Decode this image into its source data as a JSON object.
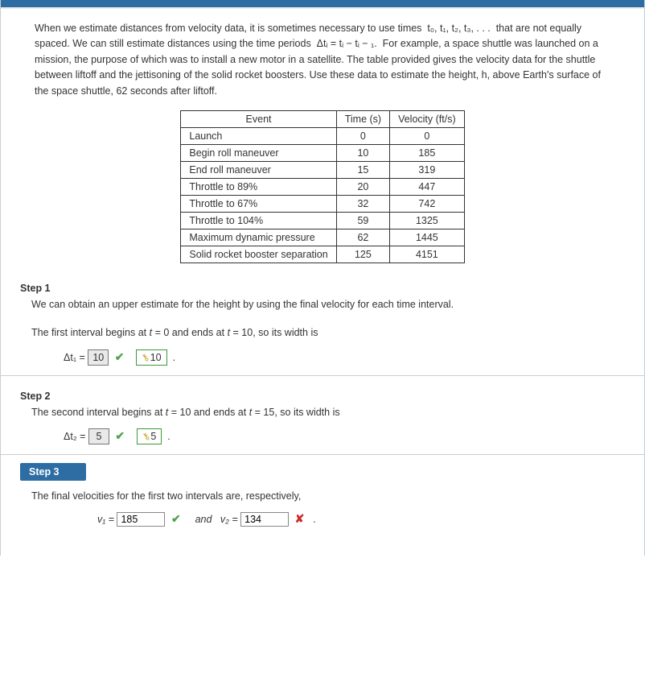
{
  "intro": "When we estimate distances from velocity data, it is sometimes necessary to use times  t₀, t₁, t₂, t₃, . . .  that are not equally spaced. We can still estimate distances using the time periods  Δtᵢ = tᵢ − tᵢ − ₁.  For example, a space shuttle was launched on a mission, the purpose of which was to install a new motor in a satellite. The table provided gives the velocity data for the shuttle between liftoff and the jettisoning of the solid rocket boosters. Use these data to estimate the height, h, above Earth's surface of the space shuttle, 62 seconds after liftoff.",
  "table": {
    "headers": {
      "event": "Event",
      "time": "Time (s)",
      "vel": "Velocity (ft/s)"
    },
    "rows": [
      {
        "event": "Launch",
        "time": "0",
        "vel": "0"
      },
      {
        "event": "Begin roll maneuver",
        "time": "10",
        "vel": "185"
      },
      {
        "event": "End roll maneuver",
        "time": "15",
        "vel": "319"
      },
      {
        "event": "Throttle to 89%",
        "time": "20",
        "vel": "447"
      },
      {
        "event": "Throttle to 67%",
        "time": "32",
        "vel": "742"
      },
      {
        "event": "Throttle to 104%",
        "time": "59",
        "vel": "1325"
      },
      {
        "event": "Maximum dynamic pressure",
        "time": "62",
        "vel": "1445"
      },
      {
        "event": "Solid rocket booster separation",
        "time": "125",
        "vel": "4151"
      }
    ]
  },
  "step1": {
    "title": "Step 1",
    "line1": "We can obtain an upper estimate for the height by using the final velocity for each time interval.",
    "line2_a": "The first interval begins at ",
    "line2_b": " = 0 and ends at ",
    "line2_c": " = 10, so its width is",
    "eq": {
      "lhs": "Δt₁ = ",
      "ans": "10",
      "reveal": "10",
      "tail": "."
    }
  },
  "step2": {
    "title": "Step 2",
    "line_a": "The second interval begins at ",
    "line_b": " = 10 and ends at ",
    "line_c": " = 15, so its width is",
    "eq": {
      "lhs": "Δt₂ = ",
      "ans": "5",
      "reveal": "5",
      "tail": "."
    }
  },
  "step3": {
    "title": "Step 3",
    "line": "The final velocities for the first two intervals are, respectively,",
    "v1_lhs": "v₁ = ",
    "v1_val": "185",
    "mid": "and   v₂ = ",
    "v2_val": "134",
    "tail": "."
  }
}
